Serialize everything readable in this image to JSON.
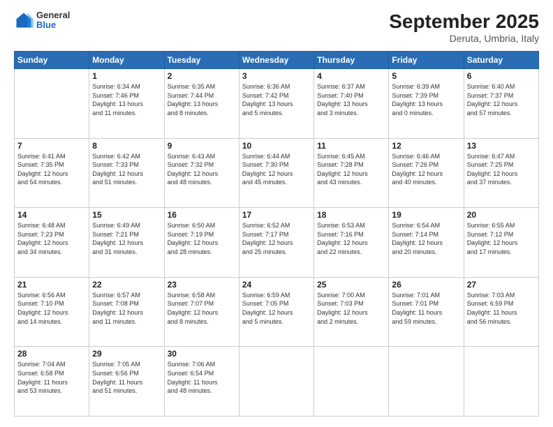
{
  "header": {
    "logo": {
      "general": "General",
      "blue": "Blue"
    },
    "title": "September 2025",
    "location": "Deruta, Umbria, Italy"
  },
  "calendar": {
    "days_of_week": [
      "Sunday",
      "Monday",
      "Tuesday",
      "Wednesday",
      "Thursday",
      "Friday",
      "Saturday"
    ],
    "weeks": [
      [
        {
          "day": "",
          "info": ""
        },
        {
          "day": "1",
          "info": "Sunrise: 6:34 AM\nSunset: 7:46 PM\nDaylight: 13 hours\nand 11 minutes."
        },
        {
          "day": "2",
          "info": "Sunrise: 6:35 AM\nSunset: 7:44 PM\nDaylight: 13 hours\nand 8 minutes."
        },
        {
          "day": "3",
          "info": "Sunrise: 6:36 AM\nSunset: 7:42 PM\nDaylight: 13 hours\nand 5 minutes."
        },
        {
          "day": "4",
          "info": "Sunrise: 6:37 AM\nSunset: 7:40 PM\nDaylight: 13 hours\nand 3 minutes."
        },
        {
          "day": "5",
          "info": "Sunrise: 6:39 AM\nSunset: 7:39 PM\nDaylight: 13 hours\nand 0 minutes."
        },
        {
          "day": "6",
          "info": "Sunrise: 6:40 AM\nSunset: 7:37 PM\nDaylight: 12 hours\nand 57 minutes."
        }
      ],
      [
        {
          "day": "7",
          "info": "Sunrise: 6:41 AM\nSunset: 7:35 PM\nDaylight: 12 hours\nand 54 minutes."
        },
        {
          "day": "8",
          "info": "Sunrise: 6:42 AM\nSunset: 7:33 PM\nDaylight: 12 hours\nand 51 minutes."
        },
        {
          "day": "9",
          "info": "Sunrise: 6:43 AM\nSunset: 7:32 PM\nDaylight: 12 hours\nand 48 minutes."
        },
        {
          "day": "10",
          "info": "Sunrise: 6:44 AM\nSunset: 7:30 PM\nDaylight: 12 hours\nand 45 minutes."
        },
        {
          "day": "11",
          "info": "Sunrise: 6:45 AM\nSunset: 7:28 PM\nDaylight: 12 hours\nand 43 minutes."
        },
        {
          "day": "12",
          "info": "Sunrise: 6:46 AM\nSunset: 7:26 PM\nDaylight: 12 hours\nand 40 minutes."
        },
        {
          "day": "13",
          "info": "Sunrise: 6:47 AM\nSunset: 7:25 PM\nDaylight: 12 hours\nand 37 minutes."
        }
      ],
      [
        {
          "day": "14",
          "info": "Sunrise: 6:48 AM\nSunset: 7:23 PM\nDaylight: 12 hours\nand 34 minutes."
        },
        {
          "day": "15",
          "info": "Sunrise: 6:49 AM\nSunset: 7:21 PM\nDaylight: 12 hours\nand 31 minutes."
        },
        {
          "day": "16",
          "info": "Sunrise: 6:50 AM\nSunset: 7:19 PM\nDaylight: 12 hours\nand 28 minutes."
        },
        {
          "day": "17",
          "info": "Sunrise: 6:52 AM\nSunset: 7:17 PM\nDaylight: 12 hours\nand 25 minutes."
        },
        {
          "day": "18",
          "info": "Sunrise: 6:53 AM\nSunset: 7:16 PM\nDaylight: 12 hours\nand 22 minutes."
        },
        {
          "day": "19",
          "info": "Sunrise: 6:54 AM\nSunset: 7:14 PM\nDaylight: 12 hours\nand 20 minutes."
        },
        {
          "day": "20",
          "info": "Sunrise: 6:55 AM\nSunset: 7:12 PM\nDaylight: 12 hours\nand 17 minutes."
        }
      ],
      [
        {
          "day": "21",
          "info": "Sunrise: 6:56 AM\nSunset: 7:10 PM\nDaylight: 12 hours\nand 14 minutes."
        },
        {
          "day": "22",
          "info": "Sunrise: 6:57 AM\nSunset: 7:08 PM\nDaylight: 12 hours\nand 11 minutes."
        },
        {
          "day": "23",
          "info": "Sunrise: 6:58 AM\nSunset: 7:07 PM\nDaylight: 12 hours\nand 8 minutes."
        },
        {
          "day": "24",
          "info": "Sunrise: 6:59 AM\nSunset: 7:05 PM\nDaylight: 12 hours\nand 5 minutes."
        },
        {
          "day": "25",
          "info": "Sunrise: 7:00 AM\nSunset: 7:03 PM\nDaylight: 12 hours\nand 2 minutes."
        },
        {
          "day": "26",
          "info": "Sunrise: 7:01 AM\nSunset: 7:01 PM\nDaylight: 11 hours\nand 59 minutes."
        },
        {
          "day": "27",
          "info": "Sunrise: 7:03 AM\nSunset: 6:59 PM\nDaylight: 11 hours\nand 56 minutes."
        }
      ],
      [
        {
          "day": "28",
          "info": "Sunrise: 7:04 AM\nSunset: 6:58 PM\nDaylight: 11 hours\nand 53 minutes."
        },
        {
          "day": "29",
          "info": "Sunrise: 7:05 AM\nSunset: 6:56 PM\nDaylight: 11 hours\nand 51 minutes."
        },
        {
          "day": "30",
          "info": "Sunrise: 7:06 AM\nSunset: 6:54 PM\nDaylight: 11 hours\nand 48 minutes."
        },
        {
          "day": "",
          "info": ""
        },
        {
          "day": "",
          "info": ""
        },
        {
          "day": "",
          "info": ""
        },
        {
          "day": "",
          "info": ""
        }
      ]
    ]
  }
}
